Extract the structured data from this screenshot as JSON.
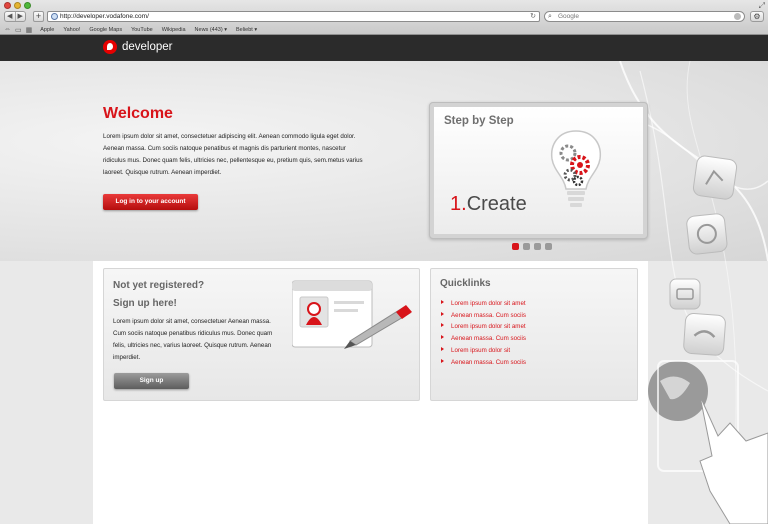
{
  "browser": {
    "url": "http://developer.vodafone.com/",
    "search_placeholder": "Google",
    "bookmarks": [
      "Apple",
      "Yahoo!",
      "Google Maps",
      "YouTube",
      "Wikipedia",
      "News (443) ▾",
      "Beliebt ▾"
    ]
  },
  "header": {
    "logo_text": "developer"
  },
  "hero": {
    "title": "Welcome",
    "text": "Lorem ipsum dolor sit amet, consectetuer adipiscing elit. Aenean commodo ligula eget dolor. Aenean massa. Cum sociis natoque penatibus et magnis dis parturient montes, nascetur ridiculus mus. Donec quam felis, ultricies nec, pellentesque eu, pretium quis, sem.metus varius laoreet. Quisque rutrum. Aenean imperdiet.",
    "login_label": "Log in to your account"
  },
  "steps": {
    "title": "Step by Step",
    "step_number": "1.",
    "step_label": "Create",
    "slide_count": 4,
    "active_slide": 1
  },
  "register": {
    "title_line1": "Not yet registered?",
    "title_line2": "Sign up here!",
    "text": "Lorem ipsum dolor sit amet, consectetuer Aenean massa. Cum sociis natoque penatibus ridiculus mus. Donec quam felis, ultricies nec, varius laoreet. Quisque rutrum. Aenean imperdiet.",
    "signup_label": "Sign up"
  },
  "quicklinks": {
    "title": "Quicklinks",
    "items": [
      "Lorem ipsum dolor sit amet",
      "Aenean massa. Cum sociis",
      "Lorem ipsum dolor sit amet",
      "Aenean massa. Cum sociis",
      "Lorem ipsum dolor sit",
      "Aenean massa. Cum sociis"
    ]
  },
  "colors": {
    "brand_red": "#d8141a",
    "header_dark": "#2b2b2b"
  }
}
